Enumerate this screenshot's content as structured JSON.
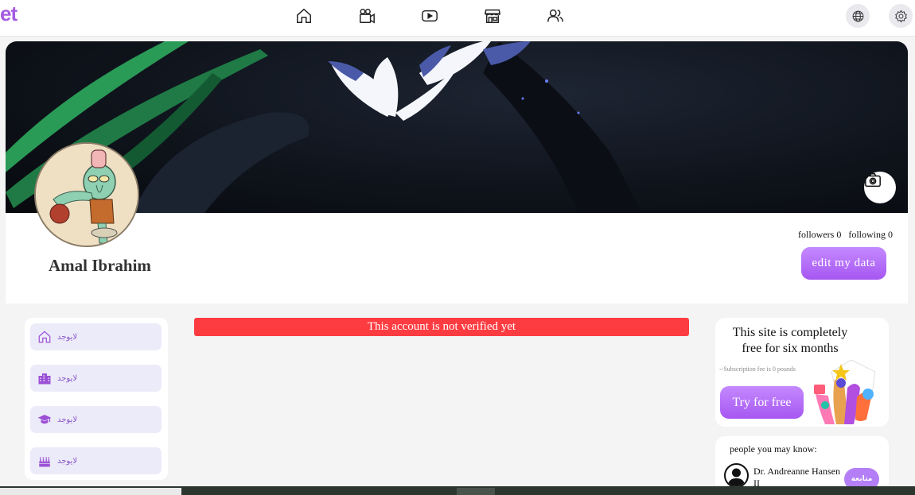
{
  "app": {
    "logo_text": "et"
  },
  "navbar": {
    "icons": [
      "home-icon",
      "video-icon",
      "play-icon",
      "store-icon",
      "users-icon"
    ],
    "right_icons": [
      "globe-icon",
      "settings-icon"
    ]
  },
  "profile": {
    "name": "Amal Ibrahim",
    "followers_label": "followers",
    "followers_count": "0",
    "following_label": "following",
    "following_count": "0",
    "edit_button": "edit my data",
    "camera_icon": "camera-icon"
  },
  "sidebar": {
    "items": [
      {
        "icon": "home-icon",
        "label": "لايوجد"
      },
      {
        "icon": "building-icon",
        "label": "لايوجد"
      },
      {
        "icon": "graduation-cap-icon",
        "label": "لايوجد"
      },
      {
        "icon": "birthday-cake-icon",
        "label": "لايوجد"
      }
    ]
  },
  "alert": {
    "text": "This account is not verified yet"
  },
  "promo": {
    "title": "This site is completely free for six months",
    "subtitle": "--Subscription fee is 0 pounds",
    "button": "Try for free"
  },
  "people": {
    "title": "people you may know:",
    "items": [
      {
        "name": "Dr. Andreanne Hansen II",
        "button": "متابعة"
      }
    ]
  },
  "colors": {
    "accent": "#a657f1",
    "alert": "#fd3c41",
    "sidebar_item_bg": "#ecebf9"
  }
}
